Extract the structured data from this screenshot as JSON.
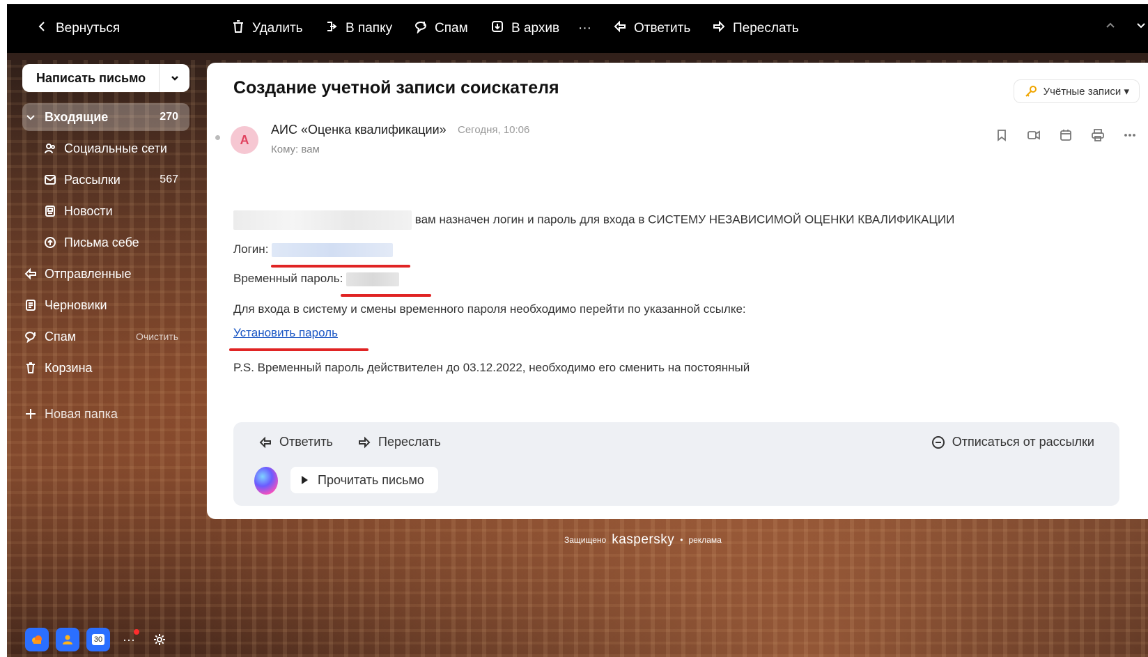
{
  "toolbar": {
    "back": "Вернуться",
    "delete": "Удалить",
    "to_folder": "В папку",
    "spam": "Спам",
    "archive": "В архив",
    "more": "···",
    "reply": "Ответить",
    "forward": "Переслать"
  },
  "sidebar": {
    "compose": "Написать письмо",
    "inbox": {
      "label": "Входящие",
      "count": "270"
    },
    "social": "Социальные сети",
    "newsletters": {
      "label": "Рассылки",
      "count": "567"
    },
    "news": "Новости",
    "to_self": "Письма себе",
    "sent": "Отправленные",
    "drafts": "Черновики",
    "spam": {
      "label": "Спам",
      "action": "Очистить"
    },
    "trash": "Корзина",
    "new_folder": "Новая папка",
    "calendar_day": "30",
    "more": "···"
  },
  "message": {
    "subject": "Создание учетной записи соискателя",
    "accounts_button": "Учётные записи ▾",
    "avatar_letter": "А",
    "sender": "АИС «Оценка квалификации»",
    "date": "Сегодня, 10:06",
    "to": "Кому: вам",
    "line1": "вам назначен логин и пароль для входа в СИСТЕМУ НЕЗАВИСИМОЙ ОЦЕНКИ КВАЛИФИКАЦИИ",
    "login_label": "Логин:",
    "temp_password_label": "Временный пароль:",
    "instructions": "Для входа в систему и смены временного пароля необходимо перейти по указанной ссылке:",
    "set_password_link": "Установить пароль",
    "ps": "P.S. Временный пароль действителен до 03.12.2022, необходимо его сменить на постоянный"
  },
  "footer": {
    "reply": "Ответить",
    "forward": "Переслать",
    "unsubscribe": "Отписаться от рассылки",
    "read_letter": "Прочитать письмо"
  },
  "ad": {
    "protected": "Защищено",
    "brand": "kaspersky",
    "dot": "•",
    "label": "реклама"
  },
  "colors": {
    "link": "#1a56c4",
    "annotation": "#e02424",
    "toolbar_bg": "#000000"
  }
}
